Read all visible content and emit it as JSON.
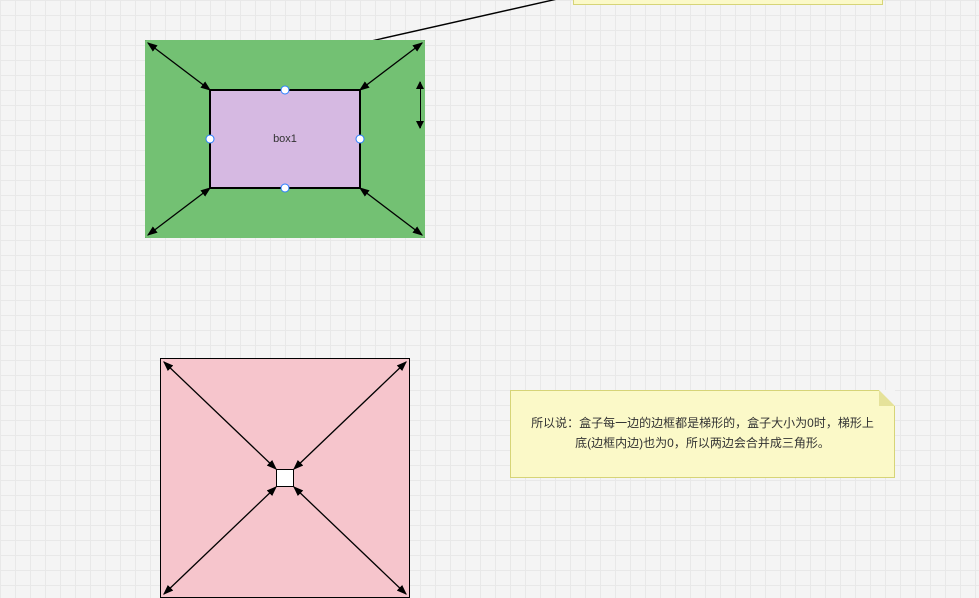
{
  "top_note": {
    "text": ""
  },
  "box1": {
    "label": "box1",
    "outer_color": "#73c173",
    "inner_color": "#d6b9e2"
  },
  "box2": {
    "center_label": "",
    "fill_color": "#f6c5cc"
  },
  "bottom_note": {
    "text": "所以说：盒子每一边的边框都是梯形的，盒子大小为0时，梯形上底(边框内边)也为0，所以两边会合并成三角形。"
  }
}
